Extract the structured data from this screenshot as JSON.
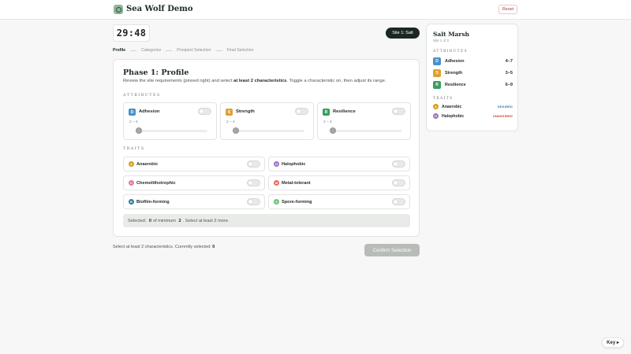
{
  "header": {
    "app_title": "Sea Wolf Demo",
    "reset_label": "Reset"
  },
  "timer": {
    "value": "29:48"
  },
  "site_pill": {
    "label": "Site 1: Salt"
  },
  "tabs": [
    {
      "label": "Profile",
      "active": true
    },
    {
      "label": "Categorize",
      "active": false
    },
    {
      "label": "Prospect Selection",
      "active": false
    },
    {
      "label": "Final Selection",
      "active": false
    }
  ],
  "phase": {
    "title": "Phase 1: Profile",
    "desc_pre": "Review the site requirements (pinned right) and select ",
    "desc_bold": "at least 2 characteristics",
    "desc_post": ". Toggle a characteristic on, then adjust its range."
  },
  "attributes_label": "ATTRIBUTES",
  "attributes": [
    {
      "letter": "D",
      "name": "Adhesion",
      "range": "2 – 4",
      "color": "#4a90c9",
      "enabled": false
    },
    {
      "letter": "S",
      "name": "Strength",
      "range": "2 – 4",
      "color": "#e0a030",
      "enabled": false
    },
    {
      "letter": "R",
      "name": "Resilience",
      "range": "2 – 4",
      "color": "#3a9d5d",
      "enabled": false
    }
  ],
  "traits_label": "TRAITS",
  "traits": [
    {
      "letter": "A",
      "name": "Anaerobic",
      "color": "#d4a017",
      "enabled": false
    },
    {
      "letter": "H",
      "name": "Halophobic",
      "color": "#a072c4",
      "enabled": false
    },
    {
      "letter": "C",
      "name": "Chemolithotrophic",
      "color": "#e07aa6",
      "enabled": false
    },
    {
      "letter": "M",
      "name": "Metal-tolerant",
      "color": "#e07060",
      "enabled": false
    },
    {
      "letter": "B",
      "name": "Biofilm-forming",
      "color": "#2f7f9e",
      "enabled": false
    },
    {
      "letter": "S",
      "name": "Spore-forming",
      "color": "#6cc27a",
      "enabled": false
    }
  ],
  "selected_bar": {
    "pre": "Selected:",
    "count": "0",
    "mid": "of minimum",
    "min": "2",
    "post": ". Select at least 2 more."
  },
  "footer": {
    "note": "Select at least 2 characteristics. Currently selected:",
    "count": "0",
    "confirm_label": "Confirm Selection"
  },
  "side_panel": {
    "title": "Salt Marsh",
    "subtitle": "Site 1 of 3",
    "attributes_label": "ATTRIBUTES",
    "attributes": [
      {
        "letter": "D",
        "name": "Adhesion",
        "value": "4–7",
        "color": "#4a90c9"
      },
      {
        "letter": "S",
        "name": "Strength",
        "value": "3–5",
        "color": "#e0a030"
      },
      {
        "letter": "R",
        "name": "Resilience",
        "value": "6–9",
        "color": "#3a9d5d"
      }
    ],
    "traits_label": "TRAITS",
    "traits": [
      {
        "letter": "A",
        "name": "Anaerobic",
        "tag": "DESIRED",
        "color": "#d4a017",
        "tag_color": "#2f6fb0"
      },
      {
        "letter": "H",
        "name": "Halophobic",
        "tag": "UNDESIRED",
        "color": "#a072c4",
        "tag_color": "#c0392b"
      }
    ]
  },
  "key_button": {
    "label": "Key ▸"
  }
}
